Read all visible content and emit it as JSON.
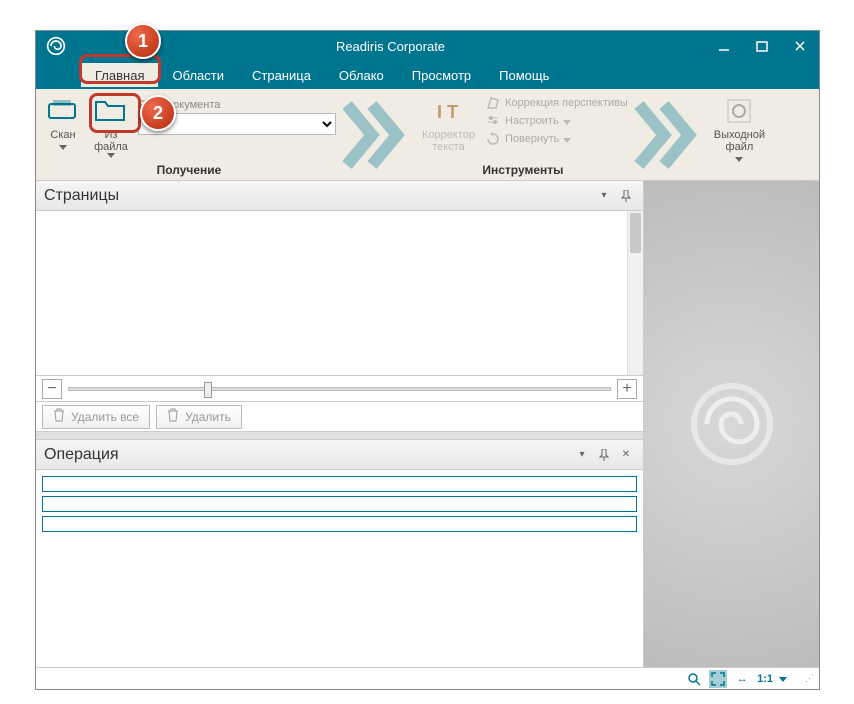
{
  "title": "Readiris Corporate",
  "tabs": [
    "Главная",
    "Области",
    "Страница",
    "Облако",
    "Просмотр",
    "Помощь"
  ],
  "ribbon": {
    "scan": "Скан",
    "fromfile": "Из\nфайла",
    "doclang_label": "Язык документа",
    "group_get": "Получение",
    "text_corrector": "Корректор\nтекста",
    "perspective": "Коррекция перспективы",
    "adjust": "Настроить",
    "rotate": "Повернуть",
    "group_tools": "Инструменты",
    "output": "Выходной\nфайл"
  },
  "panels": {
    "pages_title": "Страницы",
    "delete_all": "Удалить все",
    "delete": "Удалить",
    "ops_title": "Операция"
  },
  "status": {
    "ratio": "1:1"
  },
  "callouts": {
    "one": "1",
    "two": "2"
  }
}
